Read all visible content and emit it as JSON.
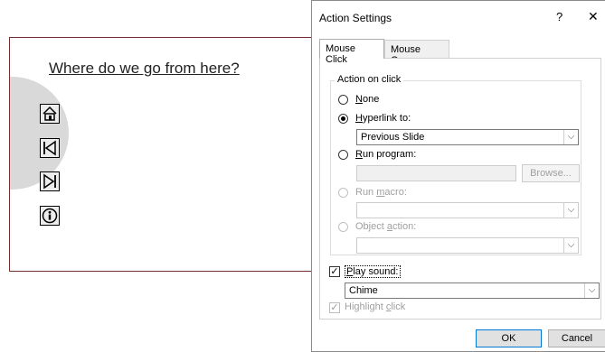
{
  "slide": {
    "title": "Where do we go from here?",
    "buttons": [
      {
        "name": "home-icon"
      },
      {
        "name": "skip-back-icon"
      },
      {
        "name": "skip-forward-icon"
      },
      {
        "name": "info-icon"
      }
    ]
  },
  "dialog": {
    "title": "Action Settings",
    "help": "?",
    "close": "✕",
    "tabs": [
      {
        "label": "Mouse Click",
        "active": true
      },
      {
        "label": "Mouse Over",
        "active": false
      }
    ],
    "group_title": "Action on click",
    "options": {
      "none": {
        "pre": "",
        "acc": "N",
        "post": "one"
      },
      "hyperlink": {
        "pre": "",
        "acc": "H",
        "post": "yperlink to:"
      },
      "run_program": {
        "pre": "",
        "acc": "R",
        "post": "un program:"
      },
      "run_macro": {
        "pre": "Run ",
        "acc": "m",
        "post": "acro:"
      },
      "object_action": {
        "pre": "Object ",
        "acc": "a",
        "post": "ction:"
      }
    },
    "hyperlink_value": "Previous Slide",
    "browse_label": "Browse...",
    "play_sound": {
      "pre": "",
      "acc": "P",
      "post": "lay sound:",
      "checked": true
    },
    "sound_value": "Chime",
    "highlight": {
      "pre": "Highlight ",
      "acc": "c",
      "post": "lick",
      "checked": true
    },
    "ok_label": "OK",
    "cancel_label": "Cancel",
    "combo_arrow": "⌵",
    "check_mark": "✓"
  }
}
